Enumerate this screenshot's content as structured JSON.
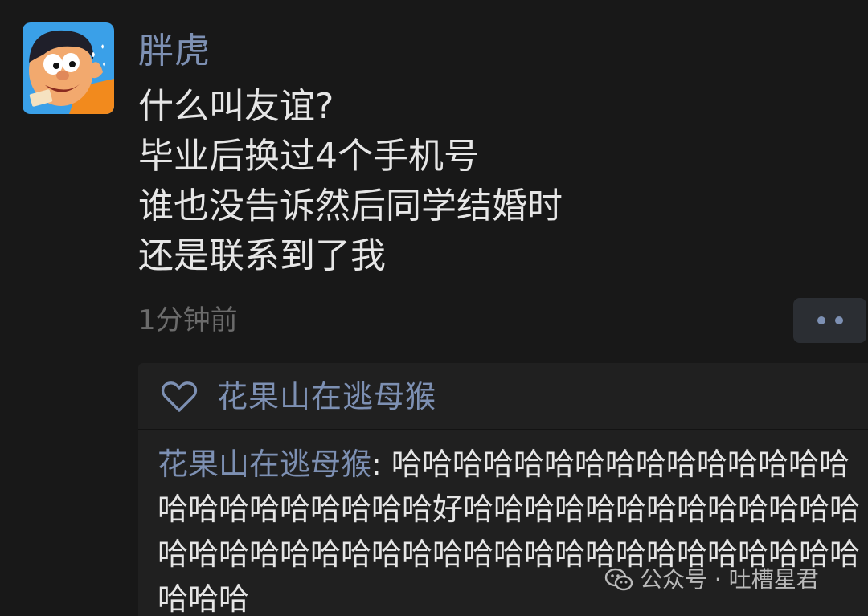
{
  "post": {
    "author": "胖虎",
    "lines": [
      "什么叫友谊?",
      "毕业后换过4个手机号",
      "谁也没告诉然后同学结婚时",
      "还是联系到了我"
    ],
    "time": "1分钟前"
  },
  "likes": {
    "names": "花果山在逃母猴"
  },
  "comment": {
    "author": "花果山在逃母猴",
    "separator": ": ",
    "text": "哈哈哈哈哈哈哈哈哈哈哈哈哈哈哈哈哈哈哈哈哈哈哈哈好哈哈哈哈哈哈哈哈哈哈哈哈哈哈哈哈哈哈哈哈哈哈哈哈哈哈哈哈哈哈哈哈哈哈哈哈哈哈哈"
  },
  "watermark": {
    "text": "公众号 · 吐槽星君",
    "icon": "wechat-icon"
  },
  "colors": {
    "background": "#181818",
    "panel": "#202020",
    "name_blue": "#7d90b3",
    "text": "#e6e6e6",
    "muted": "#6b6b6b"
  }
}
